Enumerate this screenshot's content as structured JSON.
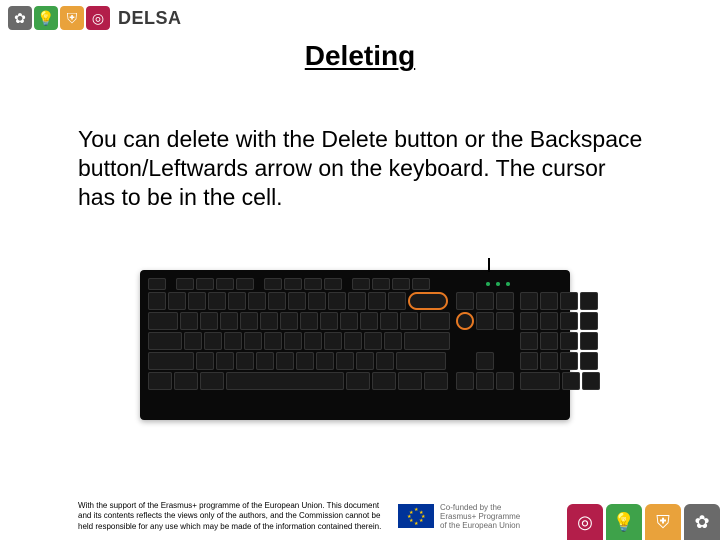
{
  "brand": {
    "name": "DELSA",
    "icons": [
      "gear-icon",
      "bulb-icon",
      "shield-icon",
      "ring-icon"
    ],
    "colors": [
      "#6a6a6a",
      "#3ea24a",
      "#e9a23b",
      "#b31e4a"
    ]
  },
  "title": "Deleting",
  "body": "You can delete with the Delete button or the Backspace button/Leftwards arrow on the keyboard. The cursor has to be in the cell.",
  "keyboard": {
    "highlighted_keys": [
      "Backspace",
      "Delete"
    ]
  },
  "footer": {
    "disclaimer": "With the support of the Erasmus+ programme of the European Union. This document and its contents reflects the views only of the authors, and the Commission cannot be held responsible for any use which may be made of the information contained therein.",
    "cofund_line1": "Co-funded by the",
    "cofund_line2": "Erasmus+ Programme",
    "cofund_line3": "of the European Union"
  },
  "corner_colors": [
    "#b31e4a",
    "#3ea24a",
    "#e9a23b",
    "#6a6a6a"
  ]
}
